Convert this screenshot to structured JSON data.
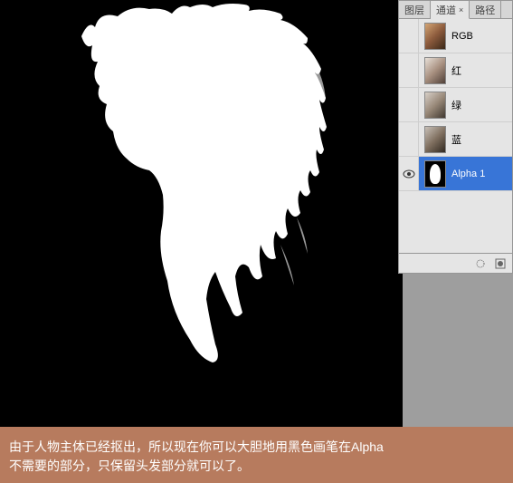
{
  "tabs": {
    "layers": "图层",
    "channels": "通道",
    "paths": "路径"
  },
  "channels": [
    {
      "label": "RGB",
      "visible": false,
      "selected": false,
      "thumbClass": "thumb-rgb"
    },
    {
      "label": "红",
      "visible": false,
      "selected": false,
      "thumbClass": "thumb-r"
    },
    {
      "label": "绿",
      "visible": false,
      "selected": false,
      "thumbClass": "thumb-g"
    },
    {
      "label": "蓝",
      "visible": false,
      "selected": false,
      "thumbClass": "thumb-b"
    },
    {
      "label": "Alpha 1",
      "visible": true,
      "selected": true,
      "thumbClass": "thumb-alpha"
    }
  ],
  "caption": {
    "line1": "由于人物主体已经抠出，所以现在你可以大胆地用黑色画笔在Alpha",
    "line2": "不需要的部分，只保留头发部分就可以了。"
  }
}
